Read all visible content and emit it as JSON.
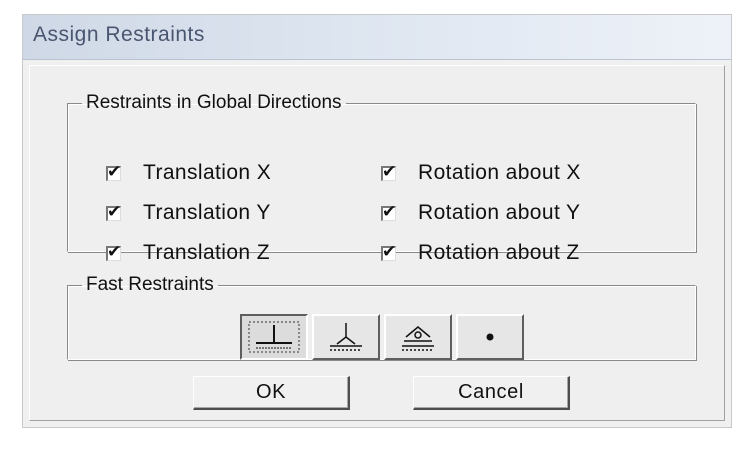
{
  "window": {
    "title": "Assign Restraints"
  },
  "directions": {
    "legend": "Restraints in Global Directions",
    "items": [
      {
        "label": "Translation  X",
        "checked": true
      },
      {
        "label": "Translation  Y",
        "checked": true
      },
      {
        "label": "Translation  Z",
        "checked": true
      },
      {
        "label": "Rotation about  X",
        "checked": true
      },
      {
        "label": "Rotation about  Y",
        "checked": true
      },
      {
        "label": "Rotation about  Z",
        "checked": true
      }
    ]
  },
  "fast": {
    "legend": "Fast Restraints",
    "buttons": [
      {
        "icon": "fixed-support-icon",
        "pressed": true
      },
      {
        "icon": "pinned-support-icon",
        "pressed": false
      },
      {
        "icon": "roller-support-icon",
        "pressed": false
      },
      {
        "icon": "free-node-icon",
        "pressed": false
      }
    ]
  },
  "buttons": {
    "ok": "OK",
    "cancel": "Cancel"
  },
  "check_mark": "✔"
}
